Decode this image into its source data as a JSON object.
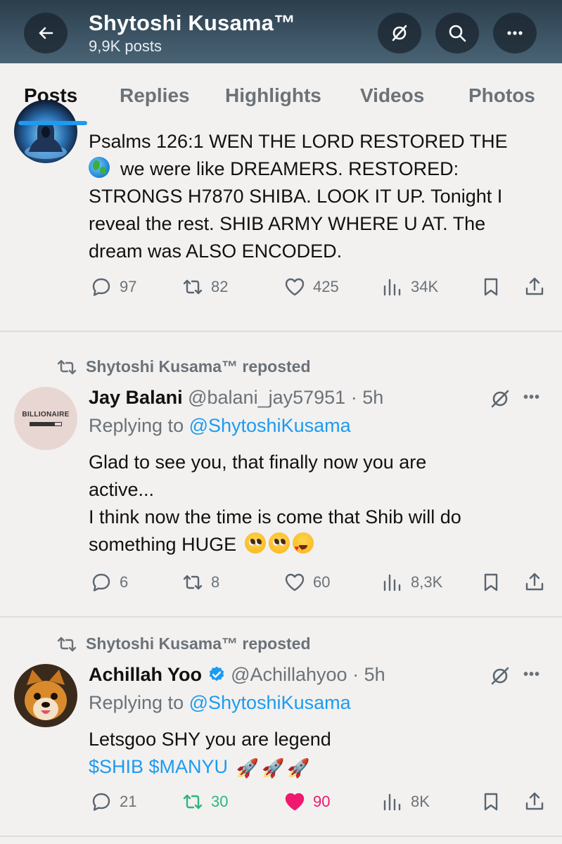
{
  "header": {
    "title": "Shytoshi Kusama™",
    "post_count": "9,9K posts",
    "icons": {
      "back": "back-arrow-icon",
      "grok": "grok-icon",
      "search": "search-icon",
      "more": "more-icon"
    }
  },
  "tabs": [
    {
      "label": "Posts",
      "active": true
    },
    {
      "label": "Replies",
      "active": false
    },
    {
      "label": "Highlights",
      "active": false
    },
    {
      "label": "Videos",
      "active": false
    },
    {
      "label": "Photos",
      "active": false
    }
  ],
  "posts": [
    {
      "text_lines": [
        "Psalms 126:1 WEN THE LORD RESTORED THE",
        "we were like DREAMERS. RESTORED:",
        "STRONGS H7870 SHIBA. LOOK IT UP. Tonight I",
        "reveal the rest. SHIB ARMY WHERE U  AT. The",
        "dream was ALSO ENCODED."
      ],
      "emoji": "earth-globe-emoji",
      "stats": {
        "replies": "97",
        "reposts": "82",
        "likes": "425",
        "views": "34K"
      }
    },
    {
      "reposted_by": "Shytoshi Kusama™ reposted",
      "author": "Jay Balani",
      "handle": "@balani_jay57951",
      "time": "· 5h",
      "replying_prefix": "Replying to ",
      "replying_to": "@ShytoshiKusama",
      "avatar_text": "BILLIONAIRE",
      "text_lines": [
        "Glad to see you, that finally now you are",
        "active...",
        "I think now the time is come that Shib will do",
        "something HUGE"
      ],
      "stats": {
        "replies": "6",
        "reposts": "8",
        "likes": "60",
        "views": "8,3K"
      }
    },
    {
      "reposted_by": "Shytoshi Kusama™ reposted",
      "author": "Achillah Yoo",
      "handle": "@Achillahyoo",
      "time": "· 5h",
      "replying_prefix": "Replying to ",
      "replying_to": "@ShytoshiKusama",
      "text_line": "Letsgoo SHY you are legend",
      "cashtags": "$SHIB $MANYU",
      "stats": {
        "replies": "21",
        "reposts": "30",
        "likes": "90",
        "views": "8K"
      }
    }
  ],
  "colors": {
    "accent": "#1d9bf0",
    "repost_active": "#2eb67a",
    "like_active": "#f0186f",
    "muted": "#6b7278"
  }
}
